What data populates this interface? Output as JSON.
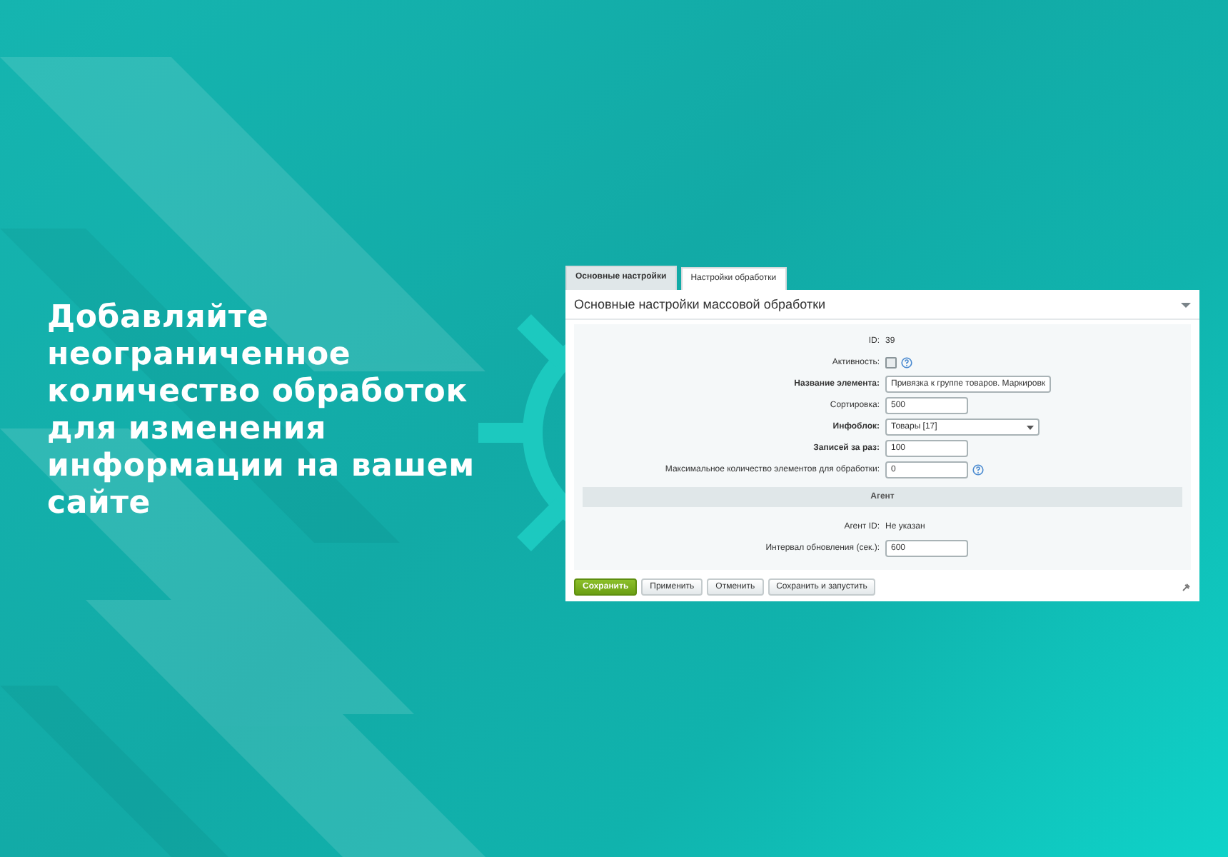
{
  "headline": "Добавляйте неограниченное количество обработок для изменения информации на вашем сайте",
  "tabs": [
    {
      "label": "Основные настройки",
      "selected": true
    },
    {
      "label": "Настройки обработки",
      "selected": false
    }
  ],
  "section_title": "Основные настройки массовой обработки",
  "fields": [
    {
      "kind": "text",
      "label": "ID:",
      "value": "39",
      "required": false
    },
    {
      "kind": "checkbox",
      "label": "Активность:",
      "checked": false,
      "help": true,
      "required": false
    },
    {
      "kind": "input",
      "label": "Название элемента:",
      "value": "Привязка к группе товаров. Маркировк",
      "required": true
    },
    {
      "kind": "input",
      "label": "Сортировка:",
      "value": "500",
      "required": false
    },
    {
      "kind": "select",
      "label": "Инфоблок:",
      "value": "Товары [17]",
      "required": true
    },
    {
      "kind": "input",
      "label": "Записей за раз:",
      "value": "100",
      "required": true
    },
    {
      "kind": "input",
      "label": "Максимальное количество элементов для обработки:",
      "value": "0",
      "required": false,
      "help": true
    },
    {
      "kind": "heading",
      "label": "Агент"
    },
    {
      "kind": "text",
      "label": "Агент ID:",
      "value": "Не указан",
      "required": false
    },
    {
      "kind": "input",
      "label": "Интервал обновления (сек.):",
      "value": "600",
      "required": false
    }
  ],
  "buttons": [
    {
      "label": "Сохранить",
      "kind": "primary"
    },
    {
      "label": "Применить",
      "kind": "default"
    },
    {
      "label": "Отменить",
      "kind": "default"
    },
    {
      "label": "Сохранить и запустить",
      "kind": "default"
    }
  ]
}
